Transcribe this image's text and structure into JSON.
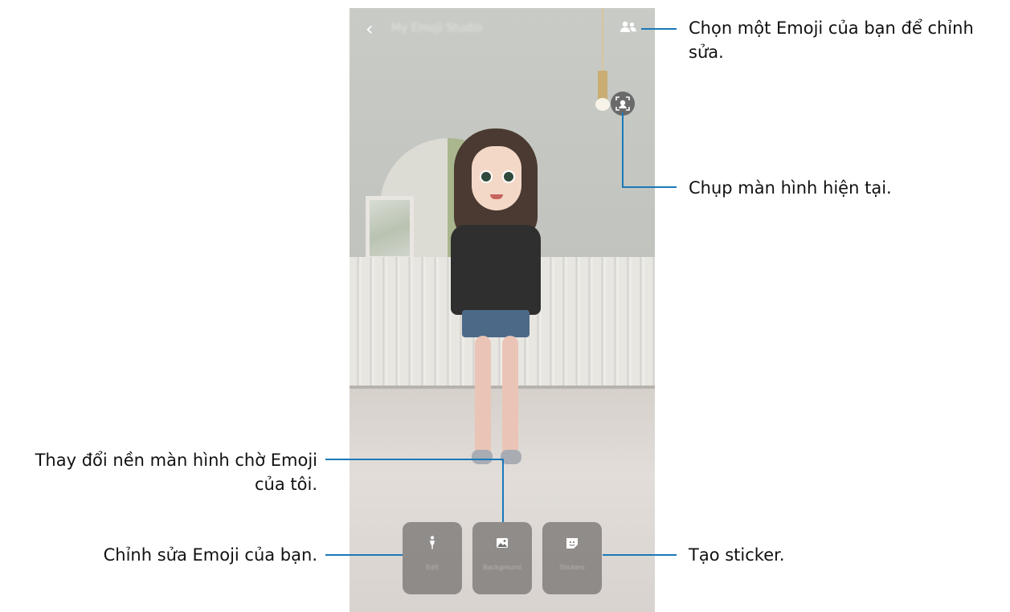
{
  "screen": {
    "title": "My Emoji Studio",
    "buttons": [
      {
        "label": "Edit"
      },
      {
        "label": "Background"
      },
      {
        "label": "Stickers"
      }
    ]
  },
  "callouts": {
    "choose_emoji": "Chọn một Emoji của bạn để chỉnh sửa.",
    "capture": "Chụp màn hình hiện tại.",
    "change_background": "Thay đổi nền màn hình chờ Emoji của tôi.",
    "edit_emoji": "Chỉnh sửa Emoji của bạn.",
    "create_sticker": "Tạo sticker."
  },
  "icons": {
    "back": "back-icon",
    "switch_emoji": "people-icon",
    "capture": "face-scan-icon",
    "edit": "person-icon",
    "background": "image-icon",
    "stickers": "sticker-icon"
  },
  "colors": {
    "callout_line": "#1a79b8",
    "tile_bg": "#78767488"
  }
}
